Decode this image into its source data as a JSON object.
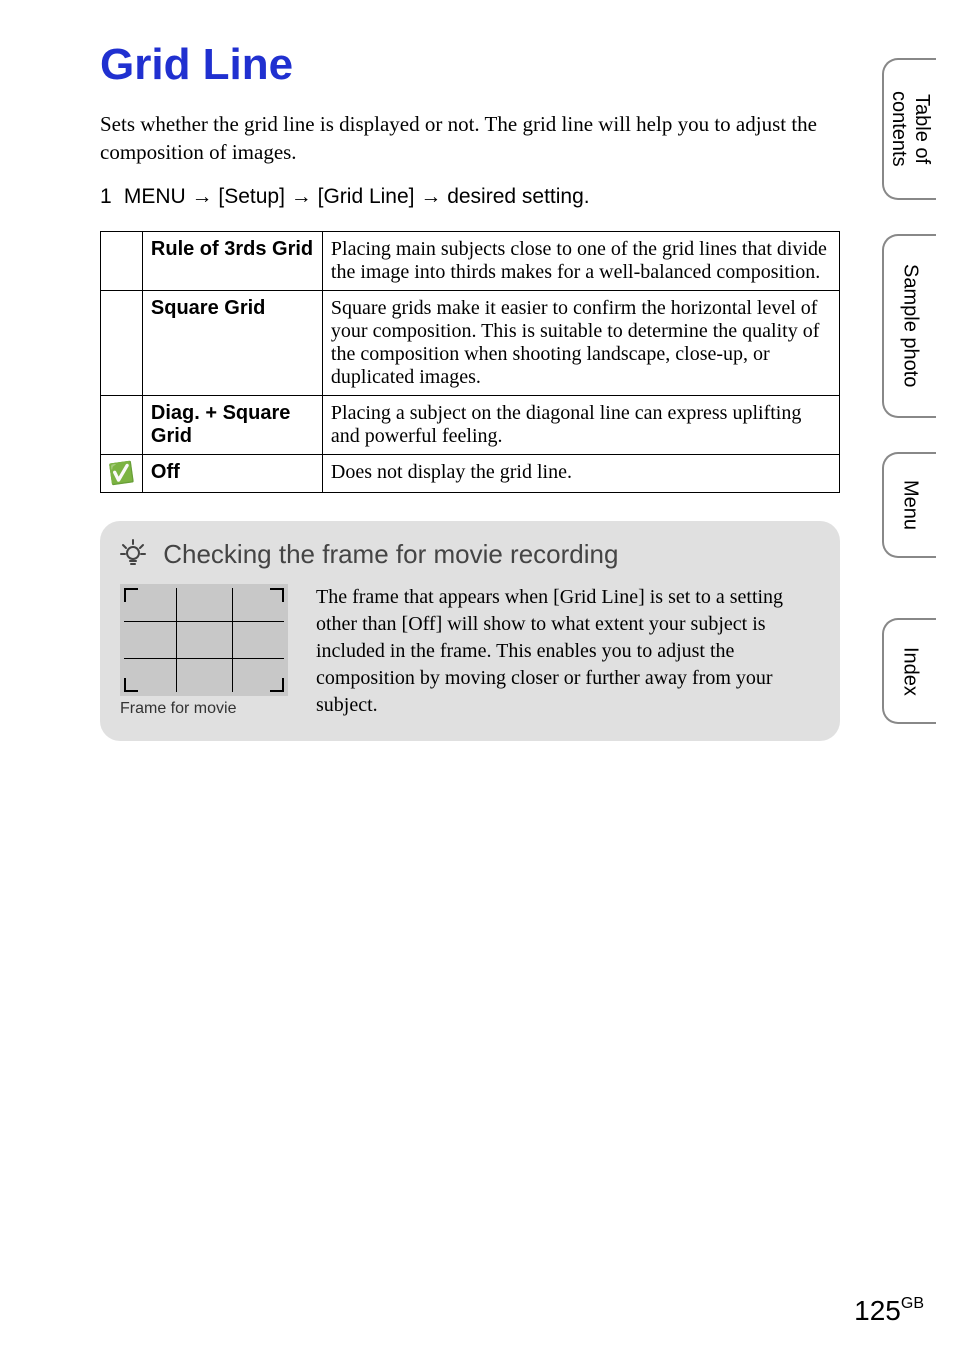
{
  "title": "Grid Line",
  "intro": "Sets whether the grid line is displayed or not. The grid line will help you to adjust the composition of images.",
  "step": {
    "num": "1",
    "parts": [
      "MENU",
      "[Setup]",
      "[Grid Line]",
      "desired setting."
    ],
    "arrow": "→"
  },
  "table": {
    "rows": [
      {
        "mark": "",
        "name": "Rule of 3rds Grid",
        "desc": "Placing main subjects close to one of the grid lines that divide the image into thirds makes for a well-balanced composition."
      },
      {
        "mark": "",
        "name": "Square Grid",
        "desc": "Square grids make it easier to confirm the horizontal level of your composition. This is suitable to determine the quality of the composition when shooting landscape, close-up, or duplicated images."
      },
      {
        "mark": "",
        "name": "Diag. + Square Grid",
        "desc": "Placing a subject on the diagonal line can express uplifting and powerful feeling."
      },
      {
        "mark": "✅",
        "name": "Off",
        "desc": "Does not display the grid line."
      }
    ]
  },
  "tip": {
    "heading": "Checking the frame for movie recording",
    "frame_caption": "Frame for movie",
    "body": "The frame that appears when [Grid Line] is set to a setting other than [Off] will show to what extent your subject is included in the frame. This enables you to adjust the composition by moving closer or further away from your subject."
  },
  "sidetabs": [
    "Table of\ncontents",
    "Sample photo",
    "Menu",
    "Index"
  ],
  "page_number": "125",
  "page_suffix": "GB"
}
